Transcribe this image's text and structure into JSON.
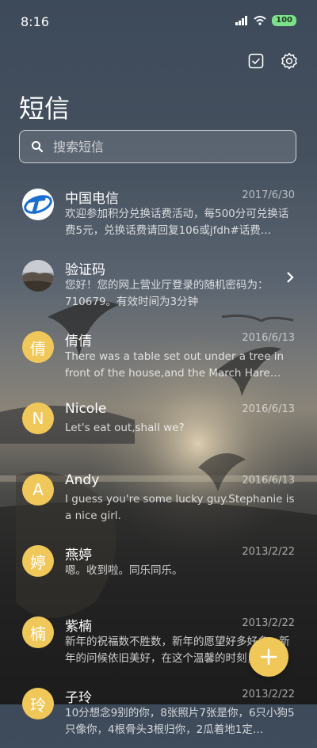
{
  "status_bar": {
    "time": "8:16",
    "battery": "100"
  },
  "header": {
    "title": "短信"
  },
  "search": {
    "placeholder": "搜索短信"
  },
  "messages": [
    {
      "name": "中国电信",
      "date": "2017/6/30",
      "preview": "欢迎参加积分兑换话费活动，每500分可兑换话费5元，兑换话费请回复106或jfdh#话费…",
      "avatar": "telecom-logo"
    },
    {
      "name": "验证码",
      "date": "",
      "preview": "您好！您的网上营业厅登录的随机密码为：710679。有效时间为3分钟",
      "avatar": "photo"
    },
    {
      "name": "倩倩",
      "date": "2016/6/13",
      "preview": "There was a table set out under a tree in front of the house,and the March Hare an…",
      "avatar_letter": "倩"
    },
    {
      "name": "Nicole",
      "date": "2016/6/13",
      "preview": "Let's eat out,shall we?",
      "avatar_letter": "N"
    },
    {
      "name": "Andy",
      "date": "2016/6/13",
      "preview": "I guess you're some lucky guy.Stephanie is a nice girl.",
      "avatar_letter": "A"
    },
    {
      "name": "燕婷",
      "date": "2013/2/22",
      "preview": "嗯。收到啦。同乐同乐。",
      "avatar_letter": "婷"
    },
    {
      "name": "紫楠",
      "date": "2013/2/22",
      "preview": "新年的祝福数不胜数，新年的愿望好多好多，新年的问候依旧美好，在这个温馨的时刻，…",
      "avatar_letter": "楠"
    },
    {
      "name": "子玲",
      "date": "2013/2/22",
      "preview": "10分想念9别的你，8张照片7张是你，6只小狗5只像你，4根骨头3根归你，2瓜着地1定…",
      "avatar_letter": "玲"
    }
  ],
  "colors": {
    "accent": "#f0c85a",
    "battery": "#7de08a"
  },
  "icons": {
    "top_left": "checkbox-icon",
    "top_right": "settings-icon",
    "fab": "plus-icon"
  }
}
